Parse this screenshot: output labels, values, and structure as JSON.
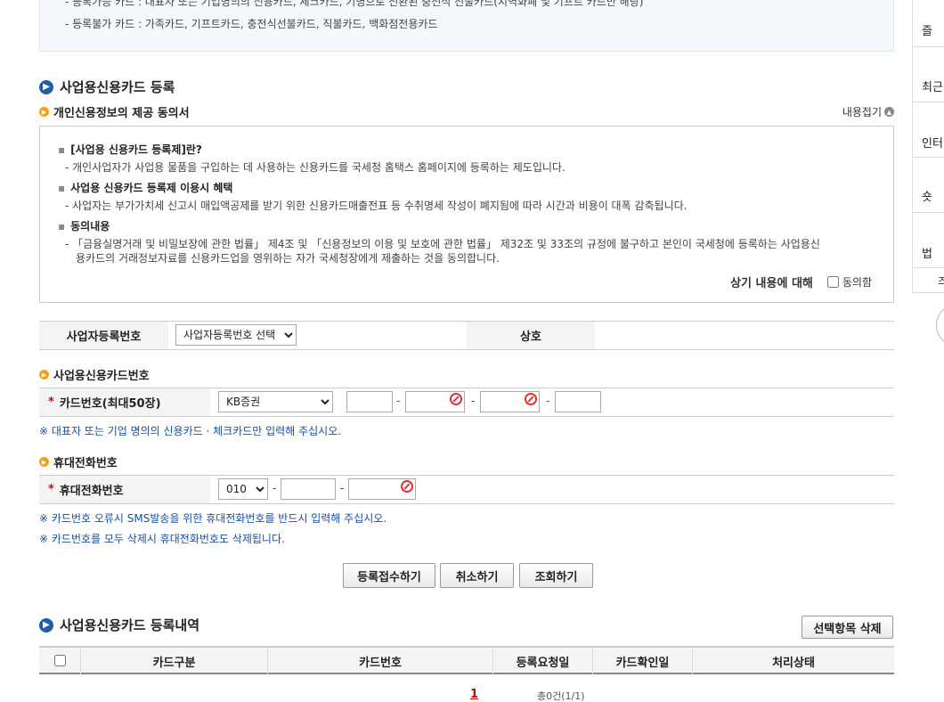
{
  "notice": {
    "line1": "- 등록가능 카드 : 대표자 또는 기업명의의 신용카드, 체크카드, 기명으로 전환된 충전식 선불카드(지역화폐 및 기프트 카드만 해당)",
    "line2": "- 등록불가 카드 : 가족카드, 기프트카드, 충전식선불카드, 직불카드, 백화점전용카드"
  },
  "register_section": {
    "title": "사업용신용카드 등록",
    "consent_title": "개인신용정보의 제공 동의서",
    "collapse_label": "내용접기",
    "items": [
      {
        "heading": "[사업용 신용카드 등록제]란?",
        "desc": "- 개인사업자가 사업용 물품을 구입하는 데 사용하는 신용카드를 국세청 홈택스 홈페이지에 등록하는 제도입니다."
      },
      {
        "heading": "사업용 신용카드 등록제 이용시 혜택",
        "desc": "- 사업자는 부가가치세 신고시 매입액공제를 받기 위한 신용카드매출전표 등 수취명세 작성이 폐지됨에 따라 시간과 비용이 대폭 감축됩니다."
      },
      {
        "heading": "동의내용",
        "desc": "- 「금융실명거래 및 비밀보장에 관한 법률」 제4조 및 「신용정보의 이용 및 보호에 관한 법률」 제32조 및 33조의 규정에 불구하고 본인이 국세청에 등록하는 사업용신",
        "desc2": "용카드의    거래정보자료를 신용카드업을 영위하는 자가 국세청장에게 제출하는 것을 동의합니다."
      }
    ],
    "agree_prefix": "상기 내용에 대해",
    "agree_label": "동의함"
  },
  "business": {
    "reg_no_label": "사업자등록번호",
    "reg_no_select": "사업자등록번호 선택",
    "company_label": "상호"
  },
  "card": {
    "section_title": "사업용신용카드번호",
    "label": "카드번호(최대50장)",
    "company_select": "KB증권",
    "note": "※ 대표자 또는 기업 명의의 신용카드 · 체크카드만 입력해 주십시오."
  },
  "phone": {
    "section_title": "휴대전화번호",
    "label": "휴대전화번호",
    "prefix_select": "010",
    "note1": "※ 카드번호 오류시 SMS발송을 위한 휴대전화번호를 반드시 입력해 주십시오.",
    "note2": "※ 카드번호를 모두 삭제시 휴대전화번호도 삭제됩니다."
  },
  "buttons": {
    "submit": "등록접수하기",
    "cancel": "취소하기",
    "search": "조회하기"
  },
  "history": {
    "title": "사업용신용카드 등록내역",
    "delete_selected": "선택항목 삭제",
    "columns": [
      "카드구분",
      "카드번호",
      "등록요청일",
      "카드확인일",
      "처리상태"
    ],
    "page": "1",
    "total": "총0건(1/1)"
  },
  "side_panel": {
    "items": [
      "즐",
      "최근",
      "인터",
      "숏",
      "법"
    ],
    "last": "즈"
  }
}
